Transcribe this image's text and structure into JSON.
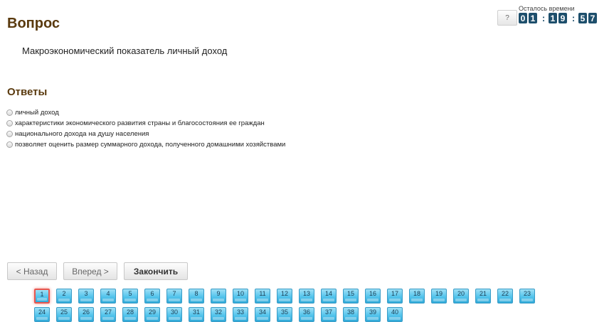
{
  "question": {
    "heading": "Вопрос",
    "text": "Макроэкономический показатель личный доход"
  },
  "answers": {
    "heading": "Ответы",
    "options": [
      "личный доход",
      "характеристики экономического развития страны и благосостояния ее граждан",
      "национального дохода на душу населения",
      "позволяет оценить размер суммарного дохода, полученного домашними хозяйствами"
    ]
  },
  "help_label": "?",
  "timer": {
    "label": "Осталось времени",
    "digits": [
      "0",
      "1",
      "1",
      "9",
      "5",
      "7"
    ],
    "separator": ":"
  },
  "nav": {
    "back": "< Назад",
    "next": "Вперед >",
    "finish": "Закончить"
  },
  "question_numbers": {
    "row1": [
      "1",
      "2",
      "3",
      "4",
      "5",
      "6",
      "7",
      "8",
      "9",
      "10",
      "11",
      "12",
      "13",
      "14",
      "15",
      "16",
      "17",
      "18",
      "19",
      "20",
      "21",
      "22",
      "23"
    ],
    "row2": [
      "24",
      "25",
      "26",
      "27",
      "28",
      "29",
      "30",
      "31",
      "32",
      "33",
      "34",
      "35",
      "36",
      "37",
      "38",
      "39",
      "40"
    ],
    "current": "1"
  },
  "colors": {
    "heading": "#5a3a0e",
    "timer_digit_bg": "#1e4f6c",
    "question_button": "#54c4ec",
    "current_border": "#e8574f"
  }
}
